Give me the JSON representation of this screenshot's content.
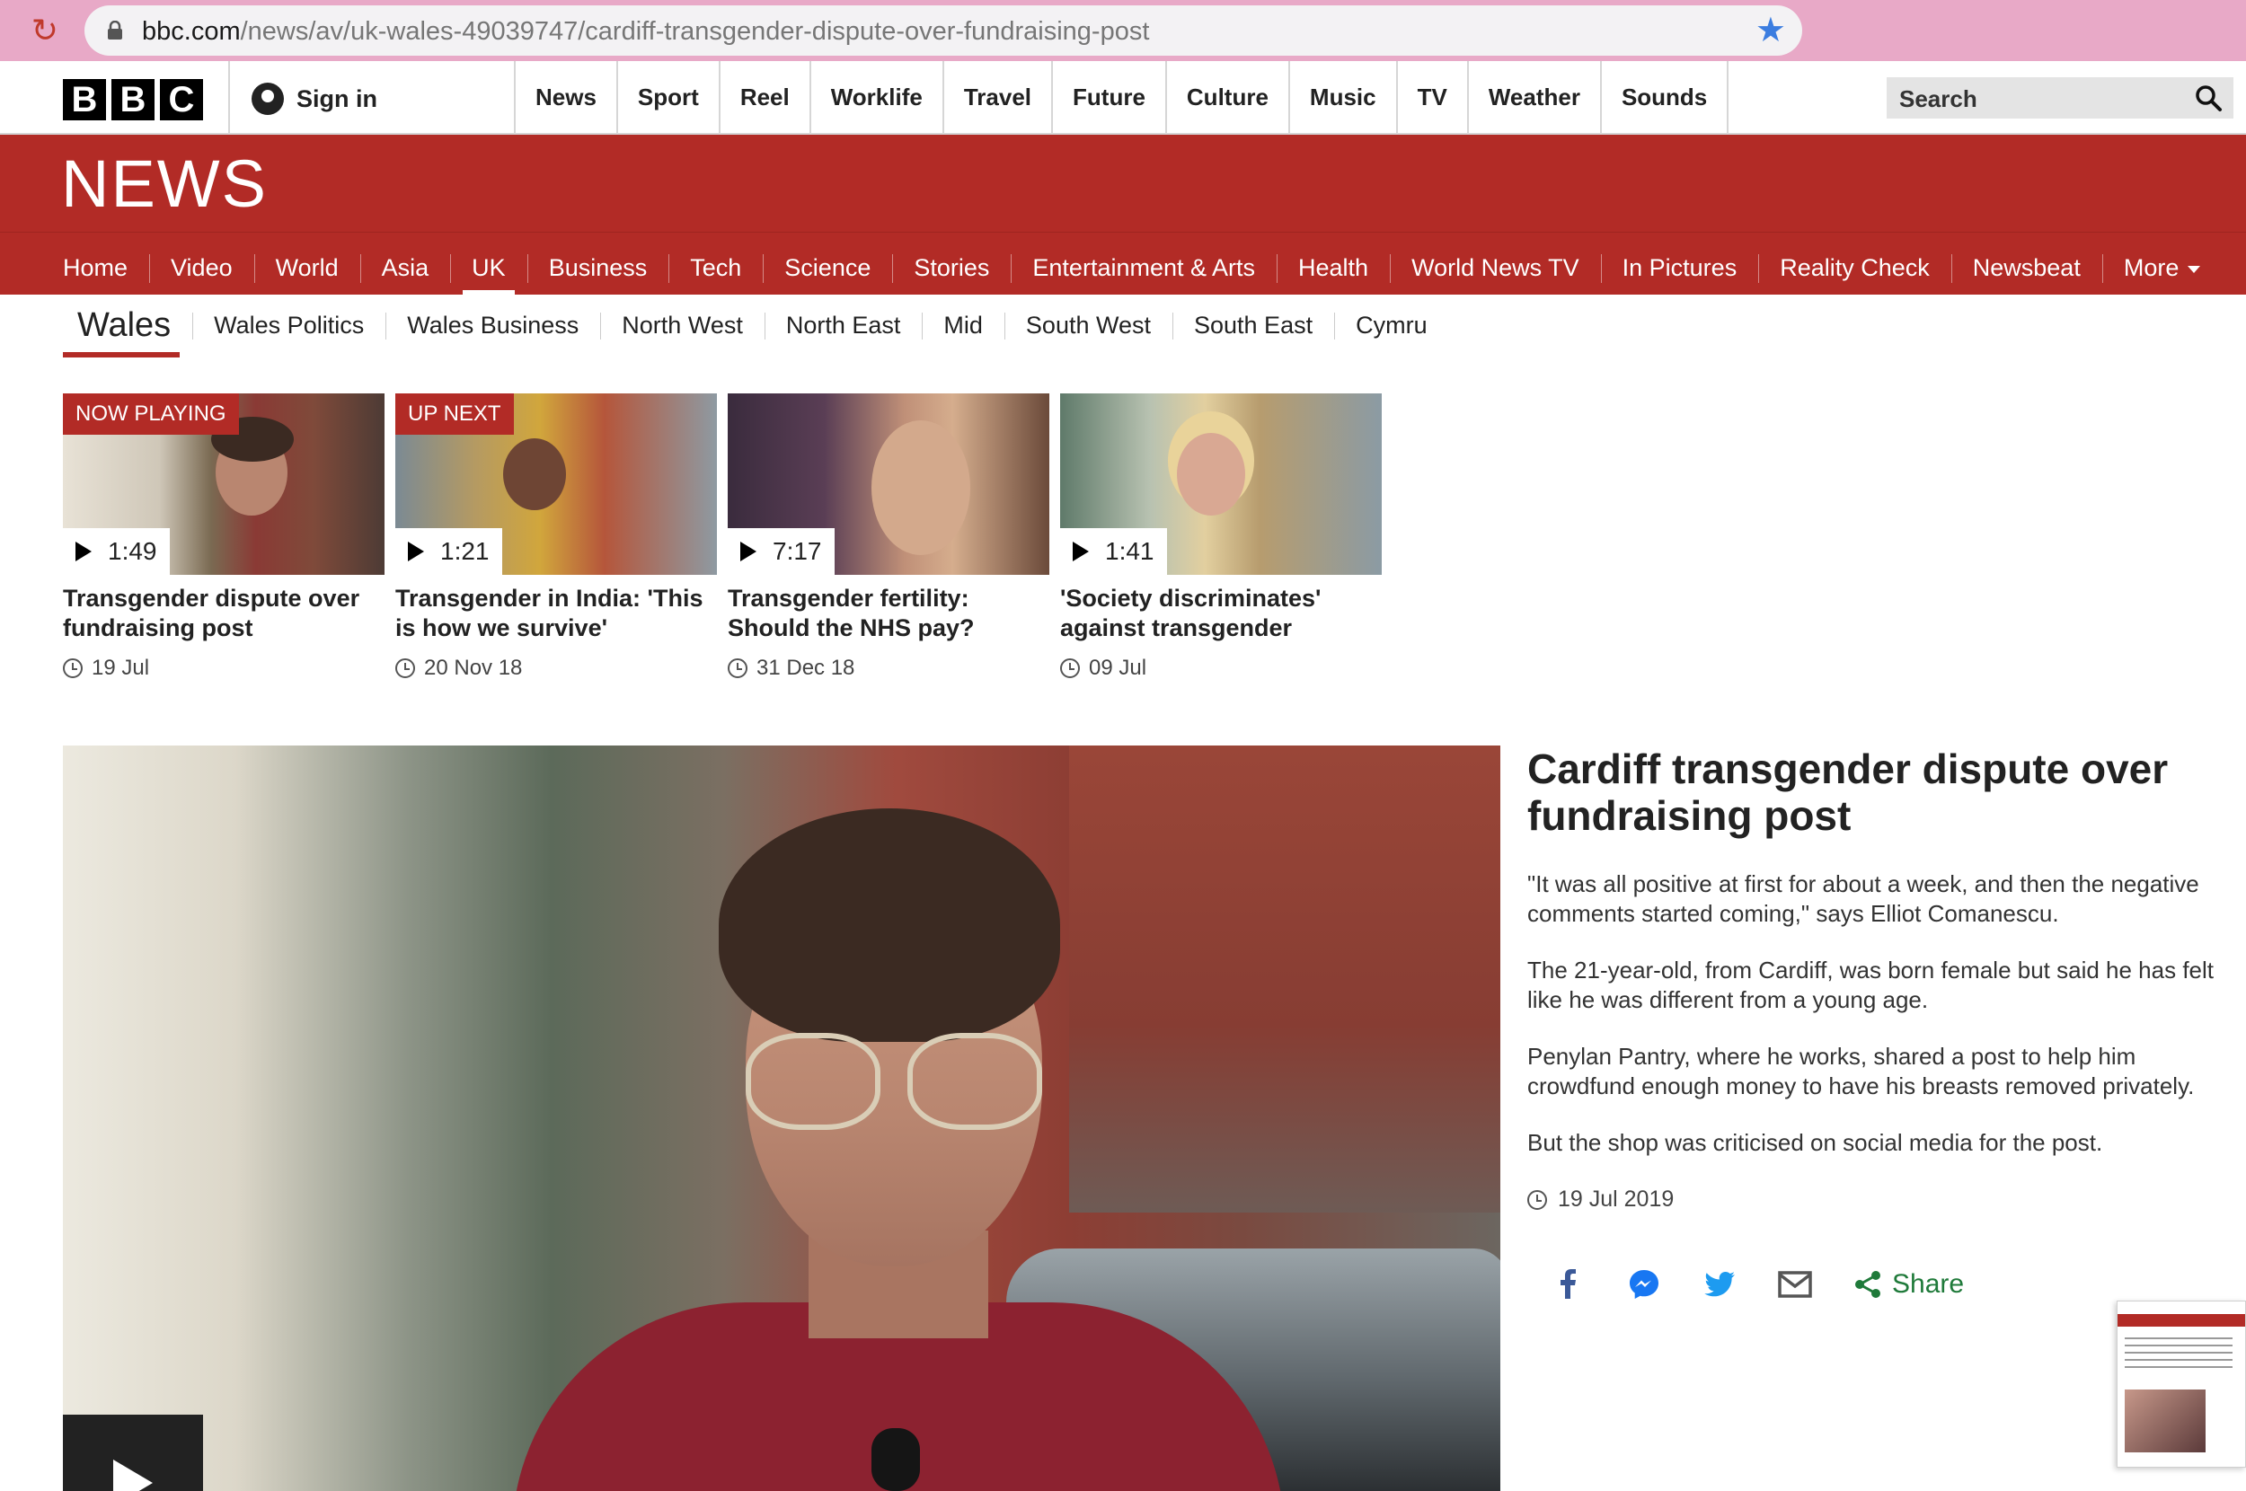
{
  "browser": {
    "url_domain": "bbc.com",
    "url_path": "/news/av/uk-wales-49039747/cardiff-transgender-dispute-over-fundraising-post"
  },
  "header": {
    "logo": [
      "B",
      "B",
      "C"
    ],
    "sign_in": "Sign in",
    "nav": [
      "News",
      "Sport",
      "Reel",
      "Worklife",
      "Travel",
      "Future",
      "Culture",
      "Music",
      "TV",
      "Weather",
      "Sounds"
    ],
    "search_label": "Search"
  },
  "news": {
    "title": "NEWS",
    "nav": [
      "Home",
      "Video",
      "World",
      "Asia",
      "UK",
      "Business",
      "Tech",
      "Science",
      "Stories",
      "Entertainment & Arts",
      "Health",
      "World News TV",
      "In Pictures",
      "Reality Check",
      "Newsbeat",
      "More"
    ],
    "active": "UK"
  },
  "subnav": {
    "section": "Wales",
    "items": [
      "Wales Politics",
      "Wales Business",
      "North West",
      "North East",
      "Mid",
      "South West",
      "South East",
      "Cymru"
    ]
  },
  "cards": [
    {
      "badge": "NOW PLAYING",
      "duration": "1:49",
      "title": "Transgender dispute over fundraising post",
      "date": "19 Jul"
    },
    {
      "badge": "UP NEXT",
      "duration": "1:21",
      "title": "Transgender in India: 'This is how we survive'",
      "date": "20 Nov 18"
    },
    {
      "badge": "",
      "duration": "7:17",
      "title": "Transgender fertility: Should the NHS pay?",
      "date": "31 Dec 18"
    },
    {
      "badge": "",
      "duration": "1:41",
      "title": "'Society discriminates' against transgender",
      "date": "09 Jul"
    }
  ],
  "article": {
    "title": "Cardiff transgender dispute over fundraising post",
    "paragraphs": [
      "\"It was all positive at first for about a week, and then the negative comments started coming,\" says Elliot Comanescu.",
      "The 21-year-old, from Cardiff, was born female but said he has felt like he was different from a young age.",
      "Penylan Pantry, where he works, shared a post to help him crowdfund enough money to have his breasts removed privately.",
      "But the shop was criticised on social media for the post."
    ],
    "date": "19 Jul 2019",
    "share_label": "Share"
  },
  "colors": {
    "bbc_red": "#b22b26",
    "share_green": "#1f7a3a",
    "twitter_blue": "#1d9bf0",
    "facebook_blue": "#3b5998"
  }
}
